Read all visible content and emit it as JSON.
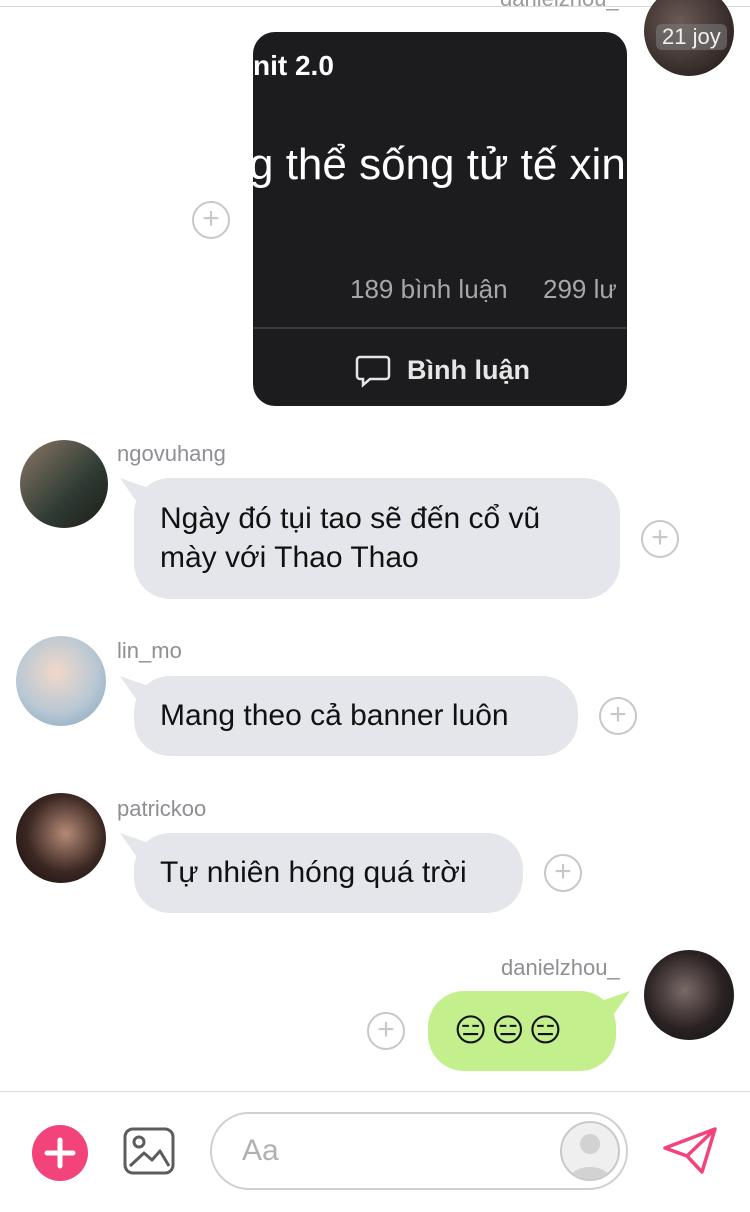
{
  "top_partial_name": "danielzhou_",
  "avatar_badge": "21 joy",
  "shared_post": {
    "title": "nit 2.0",
    "body": "g thể sống tử tế xin",
    "comments": "189 bình luận",
    "likes": "299 lư",
    "comment_button": "Bình luận"
  },
  "messages": [
    {
      "user": "ngovuhang",
      "text_line1": "Ngày đó tụi tao sẽ đến cổ vũ",
      "text_line2": "mày với Thao Thao"
    },
    {
      "user": "lin_mo",
      "text": "Mang theo cả banner luôn"
    },
    {
      "user": "patrickoo",
      "text": "Tự nhiên hóng quá trời"
    },
    {
      "user": "danielzhou_",
      "text": "😑😑😑"
    }
  ],
  "composer": {
    "placeholder": "Aa"
  },
  "colors": {
    "accent_pink": "#f2437b",
    "outgoing_bubble": "#c3ef8c",
    "incoming_bubble": "#e4e6eb"
  },
  "icons": [
    "plus-icon",
    "image-icon",
    "avatar-placeholder-icon",
    "send-icon",
    "react-plus-icon",
    "comment-icon"
  ]
}
